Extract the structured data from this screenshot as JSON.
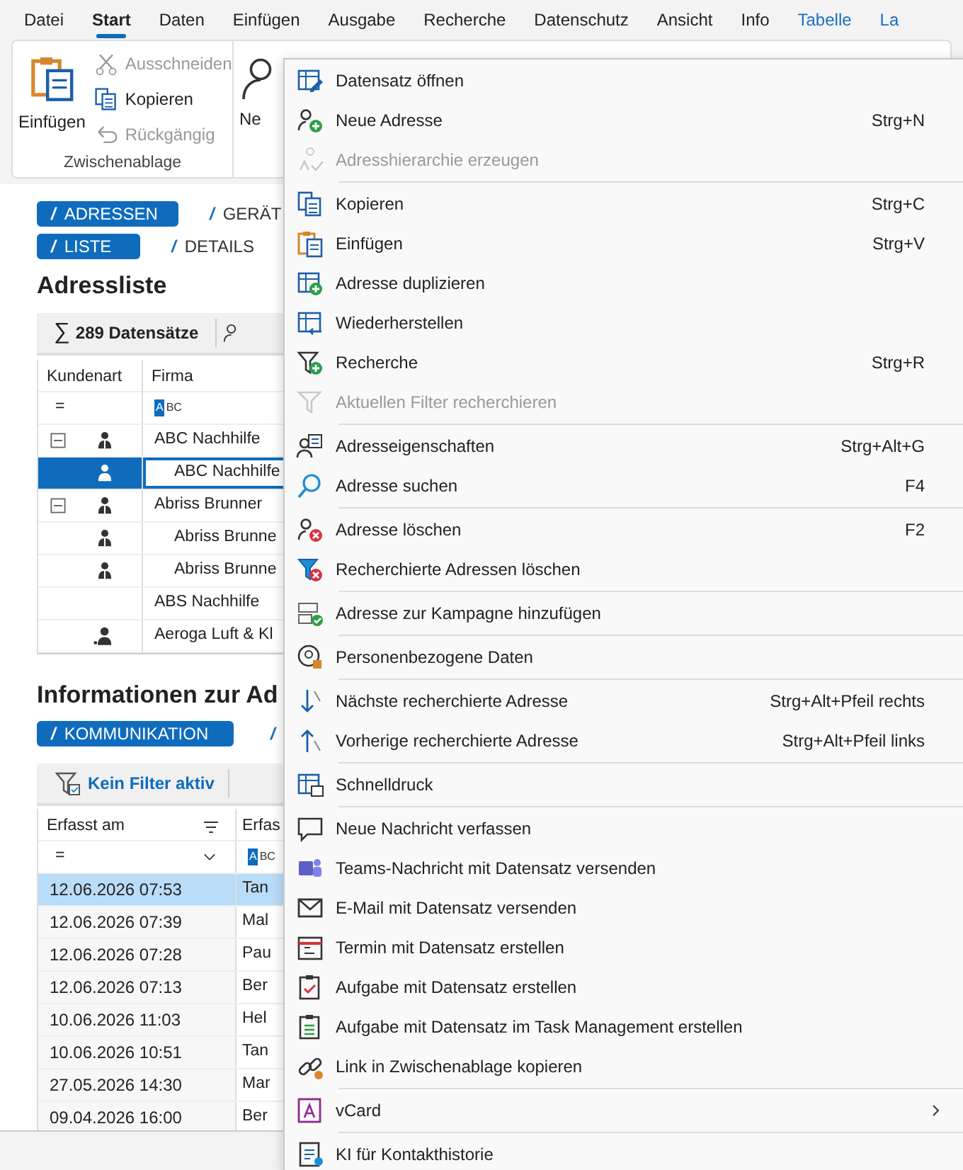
{
  "ribbon_tabs": [
    {
      "label": "Datei",
      "selected": false,
      "kind": "plain"
    },
    {
      "label": "Start",
      "selected": true,
      "kind": "plain"
    },
    {
      "label": "Daten",
      "selected": false,
      "kind": "plain"
    },
    {
      "label": "Einfügen",
      "selected": false,
      "kind": "plain"
    },
    {
      "label": "Ausgabe",
      "selected": false,
      "kind": "plain"
    },
    {
      "label": "Recherche",
      "selected": false,
      "kind": "plain"
    },
    {
      "label": "Datenschutz",
      "selected": false,
      "kind": "plain"
    },
    {
      "label": "Ansicht",
      "selected": false,
      "kind": "plain"
    },
    {
      "label": "Info",
      "selected": false,
      "kind": "plain"
    },
    {
      "label": "Tabelle",
      "selected": false,
      "kind": "context"
    },
    {
      "label": "La",
      "selected": false,
      "kind": "context"
    }
  ],
  "ribbon": {
    "clipboard": {
      "label": "Zwischenablage",
      "large_button": "Einfügen",
      "small_buttons": [
        {
          "label": "Ausschneiden",
          "disabled": true
        },
        {
          "label": "Kopieren",
          "disabled": false
        },
        {
          "label": "Rückgängig",
          "disabled": true
        }
      ]
    },
    "next_group": {
      "large_button": "Ne"
    }
  },
  "section_tabs": [
    {
      "mark": "/",
      "label": "ADRESSEN",
      "selected": true
    },
    {
      "mark": "/",
      "label": "GERÄT",
      "selected": false
    }
  ],
  "view_tabs": [
    {
      "mark": "/",
      "label": "LISTE",
      "selected": true
    },
    {
      "mark": "/",
      "label": "DETAILS",
      "selected": false
    }
  ],
  "address_list": {
    "title": "Adressliste",
    "text_filter_label": "ABC",
    "sum_symbol": "∑",
    "record_count": "289 Datensätze",
    "columns": [
      "Kundenart",
      "Firma"
    ],
    "filter_operator": "=",
    "rows": [
      {
        "firma": "ABC Nachhilfe",
        "kind": "person",
        "expanded": true,
        "selected": false,
        "children": [
          {
            "firma": "ABC Nachhilfe",
            "kind": "person",
            "selected": true
          }
        ]
      },
      {
        "firma": "Abriss Brunner",
        "kind": "person",
        "expanded": true,
        "selected": false,
        "children": [
          {
            "firma": "Abriss Brunne",
            "kind": "person",
            "selected": false
          },
          {
            "firma": "Abriss Brunne",
            "kind": "person",
            "selected": false
          }
        ]
      },
      {
        "firma": "ABS Nachhilfe",
        "kind": "none",
        "selected": false
      },
      {
        "firma": "Aeroga Luft & Kl",
        "kind": "contact",
        "selected": false
      }
    ]
  },
  "info": {
    "title": "Informationen zur Ad",
    "tabs": [
      {
        "mark": "/",
        "label": "KOMMUNIKATION",
        "selected": true
      },
      {
        "mark": "/",
        "selected": false
      }
    ],
    "filter_status": "Kein Filter aktiv",
    "text_filter_label": "ABC",
    "columns": [
      "Erfasst am",
      "Erfas"
    ],
    "filter_operator": "=",
    "rows": [
      {
        "erfasst_am": "12.06.2026 07:53",
        "column_2": "Tan",
        "selected": true
      },
      {
        "erfasst_am": "12.06.2026 07:39",
        "column_2": "Mal",
        "selected": false
      },
      {
        "erfasst_am": "12.06.2026 07:28",
        "column_2": "Pau",
        "selected": false
      },
      {
        "erfasst_am": "12.06.2026 07:13",
        "column_2": "Ber",
        "selected": false
      },
      {
        "erfasst_am": "10.06.2026 11:03",
        "column_2": "Hel",
        "selected": false
      },
      {
        "erfasst_am": "10.06.2026 10:51",
        "column_2": "Tan",
        "selected": false
      },
      {
        "erfasst_am": "27.05.2026 14:30",
        "column_2": "Mar",
        "selected": false
      },
      {
        "erfasst_am": "09.04.2026 16:00",
        "column_2": "Ber",
        "selected": false
      }
    ]
  },
  "context_menu": {
    "groups": [
      [
        {
          "label": "Datensatz öffnen",
          "disabled": false
        },
        {
          "label": "Neue Adresse",
          "shortcut": "Strg+N",
          "disabled": false
        },
        {
          "label": "Adresshierarchie erzeugen",
          "disabled": true
        }
      ],
      [
        {
          "label": "Kopieren",
          "shortcut": "Strg+C",
          "disabled": false
        },
        {
          "label": "Einfügen",
          "shortcut": "Strg+V",
          "disabled": false
        },
        {
          "label": "Adresse duplizieren",
          "disabled": false
        },
        {
          "label": "Wiederherstellen",
          "disabled": false
        },
        {
          "label": "Recherche",
          "shortcut": "Strg+R",
          "disabled": false
        },
        {
          "label": "Aktuellen Filter recherchieren",
          "disabled": true
        }
      ],
      [
        {
          "label": "Adresseigenschaften",
          "shortcut": "Strg+Alt+G",
          "disabled": false
        },
        {
          "label": "Adresse suchen",
          "shortcut": "F4",
          "disabled": false
        }
      ],
      [
        {
          "label": "Adresse löschen",
          "shortcut": "F2",
          "disabled": false
        },
        {
          "label": "Recherchierte Adressen löschen",
          "disabled": false
        }
      ],
      [
        {
          "label": "Adresse zur Kampagne hinzufügen",
          "disabled": false
        }
      ],
      [
        {
          "label": "Personenbezogene Daten",
          "disabled": false
        }
      ],
      [
        {
          "label": "Nächste recherchierte Adresse",
          "shortcut": "Strg+Alt+Pfeil rechts",
          "disabled": false
        },
        {
          "label": "Vorherige recherchierte Adresse",
          "shortcut": "Strg+Alt+Pfeil links",
          "disabled": false
        }
      ],
      [
        {
          "label": "Schnelldruck",
          "disabled": false
        }
      ],
      [
        {
          "label": "Neue Nachricht verfassen",
          "disabled": false
        },
        {
          "label": "Teams-Nachricht mit Datensatz versenden",
          "disabled": false
        },
        {
          "label": "E-Mail mit Datensatz versenden",
          "disabled": false
        },
        {
          "label": "Termin mit Datensatz erstellen",
          "disabled": false
        },
        {
          "label": "Aufgabe mit Datensatz erstellen",
          "disabled": false
        },
        {
          "label": "Aufgabe mit Datensatz im Task Management erstellen",
          "disabled": false
        },
        {
          "label": "Link in Zwischenablage kopieren",
          "disabled": false
        }
      ],
      [
        {
          "label": "vCard",
          "submenu": true,
          "disabled": false
        }
      ],
      [
        {
          "label": "KI für Kontakthistorie",
          "disabled": false
        }
      ]
    ]
  }
}
